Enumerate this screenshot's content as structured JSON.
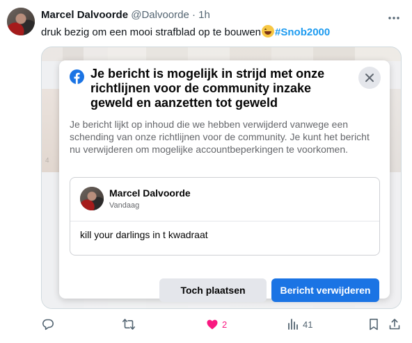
{
  "tweet": {
    "author_name": "Marcel Dalvoorde",
    "author_handle": "@Dalvoorde",
    "separator": "·",
    "time": "1h",
    "text_before_emoji": "druk bezig om een mooi strafblad op te bouwen",
    "emoji": "grinning-sweat-emoji",
    "hashtag": "#Snob2000"
  },
  "dialog": {
    "title": "Je bericht is mogelijk in strijd met onze richtlijnen voor de community inzake geweld en aanzetten tot geweld",
    "body": "Je bericht lijkt op inhoud die we hebben verwijderd vanwege een schending van onze richtlijnen voor de community. Je kunt het bericht nu verwijderen om mogelijke accountbeperkingen te voorkomen.",
    "preview": {
      "author_name": "Marcel Dalvoorde",
      "date": "Vandaag",
      "text": "kill your darlings in t kwadraat"
    },
    "buttons": {
      "keep": "Toch plaatsen",
      "delete": "Bericht verwijderen"
    }
  },
  "actions": {
    "reply_count": "",
    "retweet_count": "",
    "like_count": "2",
    "views_count": "41"
  },
  "colors": {
    "twitter_blue": "#1d9bf0",
    "like_pink": "#f91880",
    "facebook_blue": "#1b74e4"
  },
  "icons": [
    "more-icon",
    "facebook-icon",
    "close-icon",
    "reply-icon",
    "retweet-icon",
    "like-icon",
    "views-icon",
    "bookmark-icon",
    "share-icon"
  ]
}
